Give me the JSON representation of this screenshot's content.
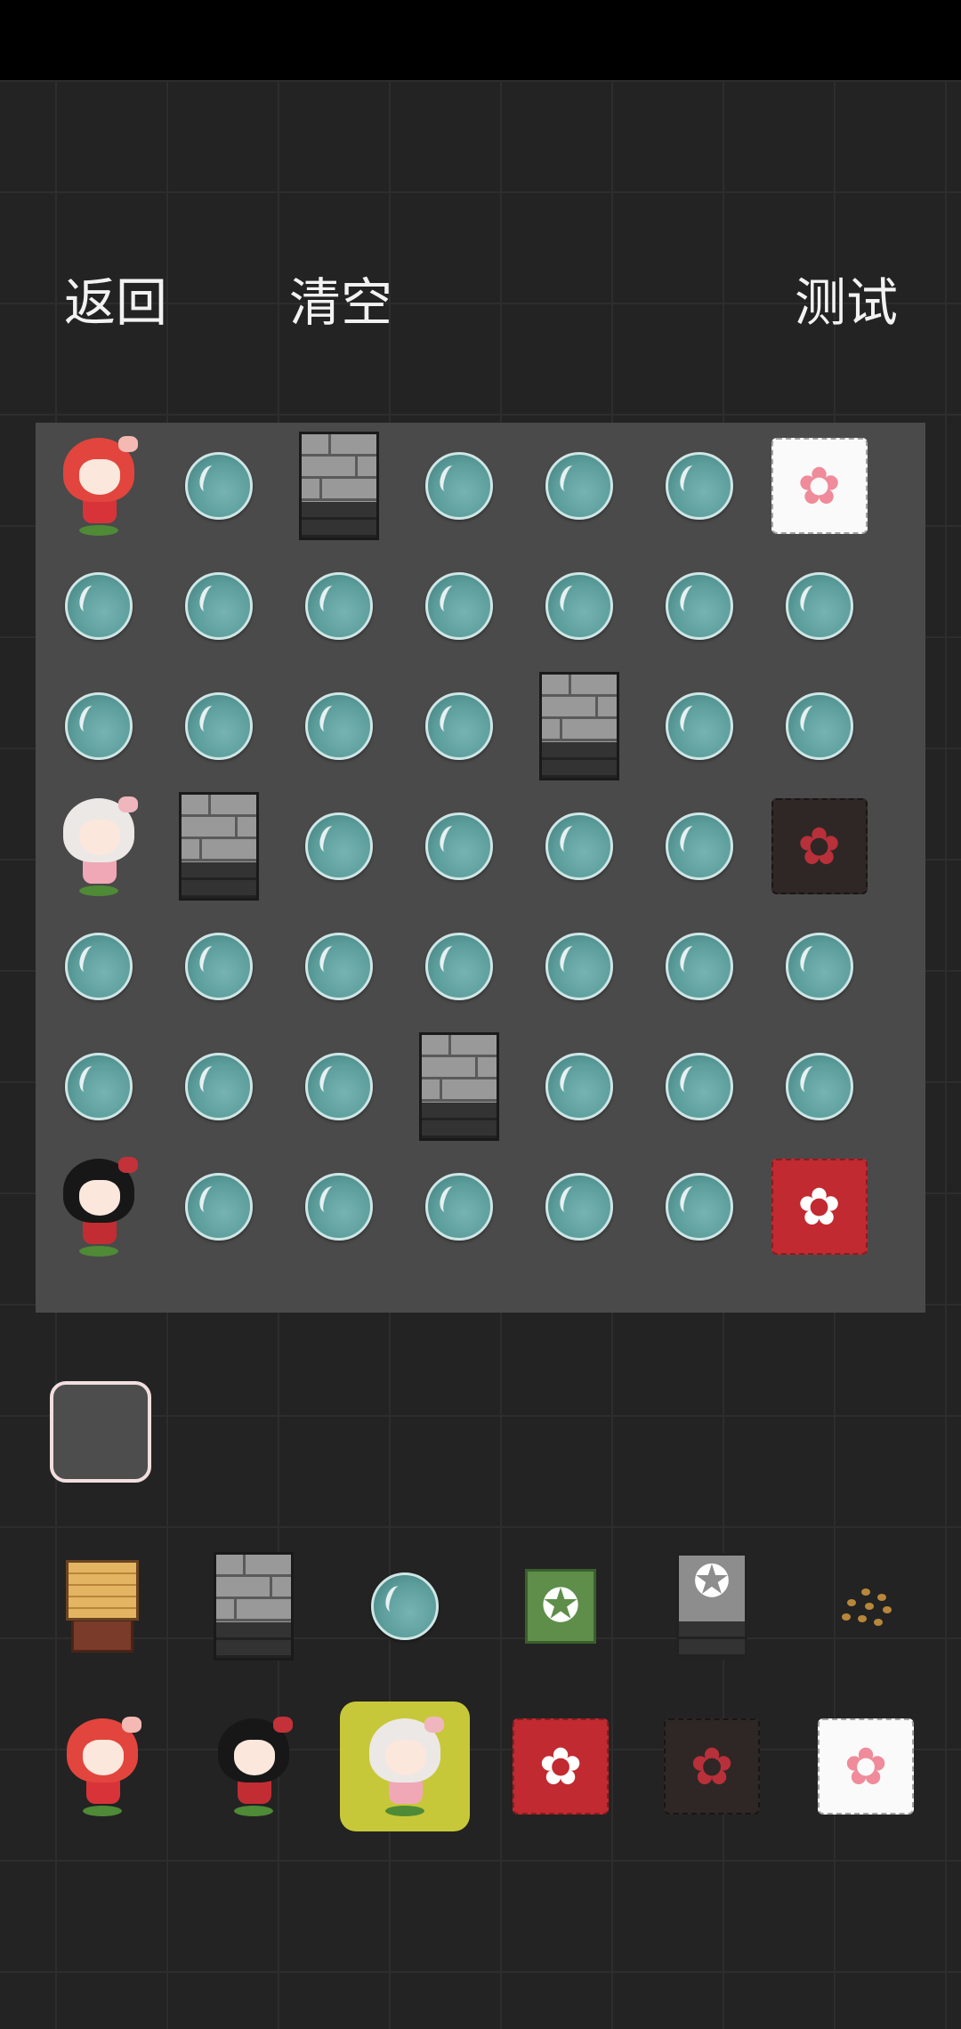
{
  "toolbar": {
    "back_label": "返回",
    "clear_label": "清空",
    "test_label": "测试"
  },
  "board": {
    "columns": 7,
    "rows": 7,
    "cells": [
      [
        "girl-red",
        "bubble",
        "wall",
        "bubble",
        "bubble",
        "bubble",
        "tile-white"
      ],
      [
        "bubble",
        "bubble",
        "bubble",
        "bubble",
        "bubble",
        "bubble",
        "bubble"
      ],
      [
        "bubble",
        "bubble",
        "bubble",
        "bubble",
        "wall",
        "bubble",
        "bubble"
      ],
      [
        "girl-white",
        "wall",
        "bubble",
        "bubble",
        "bubble",
        "bubble",
        "tile-dark"
      ],
      [
        "bubble",
        "bubble",
        "bubble",
        "bubble",
        "bubble",
        "bubble",
        "bubble"
      ],
      [
        "bubble",
        "bubble",
        "bubble",
        "wall",
        "bubble",
        "bubble",
        "bubble"
      ],
      [
        "girl-black",
        "bubble",
        "bubble",
        "bubble",
        "bubble",
        "bubble",
        "tile-red"
      ]
    ]
  },
  "palette": {
    "row1": [
      "crate",
      "wall",
      "bubble",
      "pentagram-tile",
      "pentagram-wall",
      "scattered-dots"
    ],
    "row2": [
      "girl-red",
      "girl-black",
      "girl-white",
      "tile-red",
      "tile-dark",
      "tile-white"
    ],
    "selected": "girl-white"
  },
  "icons": {
    "flower_glyph": "✿",
    "star_glyph": "✪"
  },
  "colors": {
    "background": "#232323",
    "board": "#4a4a4a",
    "selection": "#c7c839",
    "bubble": "#5c9e9c"
  }
}
